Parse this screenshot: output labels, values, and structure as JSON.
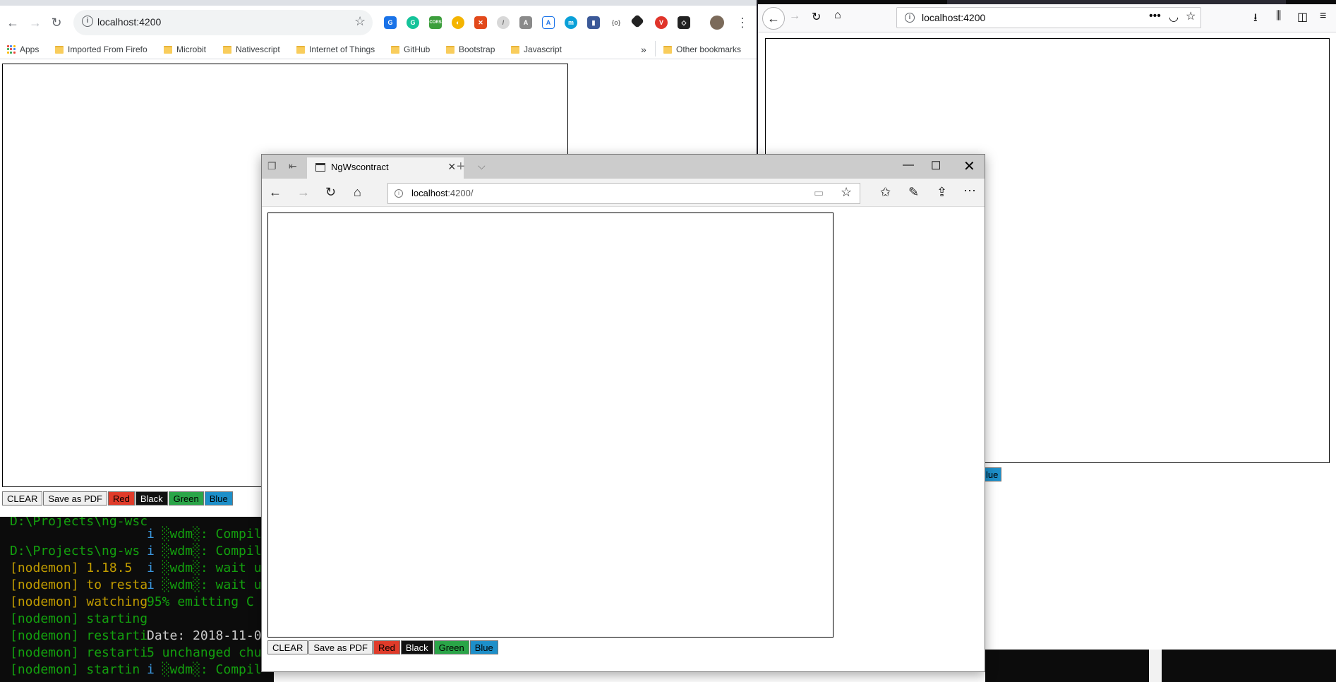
{
  "chrome": {
    "tab_title": "NgWscontract",
    "url": "localhost:4200",
    "bookmarks": [
      {
        "label": "Apps",
        "type": "apps"
      },
      {
        "label": "Imported From Firefo",
        "type": "folder"
      },
      {
        "label": "Microbit",
        "type": "folder"
      },
      {
        "label": "Nativescript",
        "type": "folder"
      },
      {
        "label": "Internet of Things",
        "type": "folder"
      },
      {
        "label": "GitHub",
        "type": "folder"
      },
      {
        "label": "Bootstrap",
        "type": "folder"
      },
      {
        "label": "Javascript",
        "type": "folder"
      }
    ],
    "overflow": "»",
    "other_bookmarks": "Other bookmarks",
    "buttons": {
      "clear": "CLEAR",
      "save": "Save as PDF",
      "red": "Red",
      "black": "Black",
      "green": "Green",
      "blue": "Blue"
    }
  },
  "firefox": {
    "url": "localhost:4200",
    "visible_button": "lue"
  },
  "edge": {
    "tab_title": "NgWscontract",
    "url_host": "localhost",
    "url_rest": ":4200/",
    "buttons": {
      "clear": "CLEAR",
      "save": "Save as PDF",
      "red": "Red",
      "black": "Black",
      "green": "Green",
      "blue": "Blue"
    }
  },
  "terminal_left": [
    {
      "text": "D:\\Projects\\ng-ws",
      "color": "g"
    },
    {
      "text": "[nodemon] 1.18.5",
      "color": "y"
    },
    {
      "text": "[nodemon] to resta",
      "color": "y"
    },
    {
      "text": "[nodemon] watching",
      "color": "y"
    },
    {
      "text": "[nodemon] starting",
      "color": "g"
    },
    {
      "text": "[nodemon] restarti",
      "color": "g"
    },
    {
      "text": "[nodemon] restarti",
      "color": "g"
    },
    {
      "text": "[nodemon] startin",
      "color": "g"
    }
  ],
  "terminal_right": [
    {
      "prefix": "i ",
      "text": "░wdm░: Compil"
    },
    {
      "prefix": "i ",
      "text": "░wdm░: Compil"
    },
    {
      "prefix": "i ",
      "text": "░wdm░: wait u"
    },
    {
      "prefix": "i ",
      "text": "░wdm░: wait u"
    },
    {
      "prefix": "",
      "text": "95% emitting C"
    },
    {
      "prefix": "",
      "text": ""
    },
    {
      "prefix": "",
      "text": "Date: 2018-11-0"
    },
    {
      "prefix": "",
      "text": "5 unchanged chu"
    },
    {
      "prefix": "i ",
      "text": "░wdm░: Compil"
    }
  ]
}
